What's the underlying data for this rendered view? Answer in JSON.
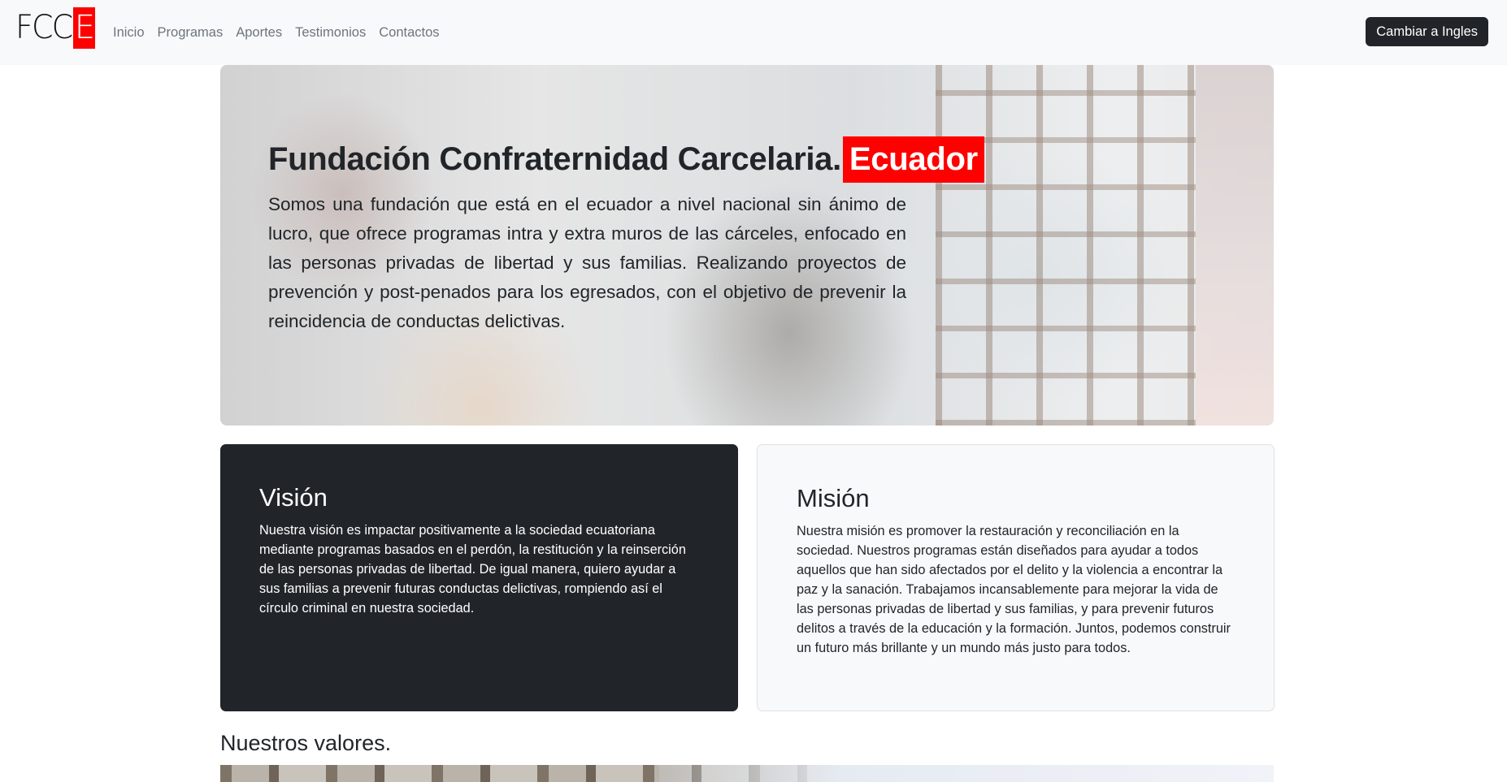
{
  "navbar": {
    "logo_text": "FCC",
    "logo_box": "E",
    "links": [
      "Inicio",
      "Programas",
      "Aportes",
      "Testimonios",
      "Contactos"
    ],
    "switch_language_label": "Cambiar a Ingles"
  },
  "hero": {
    "title": "Fundación Confraternidad Carcelaria.",
    "title_highlight": "Ecuador",
    "description": "Somos una fundación que está en el ecuador a nivel nacional sin ánimo de lucro, que ofrece programas intra y extra muros de las cárceles, enfocado en las personas privadas de libertad y sus familias. Realizando proyectos de prevención y post-penados para los egresados, con el objetivo de prevenir la reincidencia de conductas delictivas."
  },
  "vision": {
    "title": "Visión",
    "text": "Nuestra visión es impactar positivamente a la sociedad ecuatoriana mediante programas basados en el perdón, la restitución y la reinserción de las personas privadas de libertad. De igual manera, quiero ayudar a sus familias a prevenir futuras conductas delictivas, rompiendo así el círculo criminal en nuestra sociedad."
  },
  "mision": {
    "title": "Misión",
    "text": "Nuestra misión es promover la restauración y reconciliación en la sociedad. Nuestros programas están diseñados para ayudar a todos aquellos que han sido afectados por el delito y la violencia a encontrar la paz y la sanación. Trabajamos incansablemente para mejorar la vida de las personas privadas de libertad y sus familias, y para prevenir futuros delitos a través de la educación y la formación. Juntos, podemos construir un futuro más brillante y un mundo más justo para todos."
  },
  "values": {
    "title": "Nuestros valores."
  },
  "colors": {
    "accent": "#ff0000",
    "dark": "#212529",
    "light": "#f8f9fa",
    "nav_link": "#6c757d"
  }
}
